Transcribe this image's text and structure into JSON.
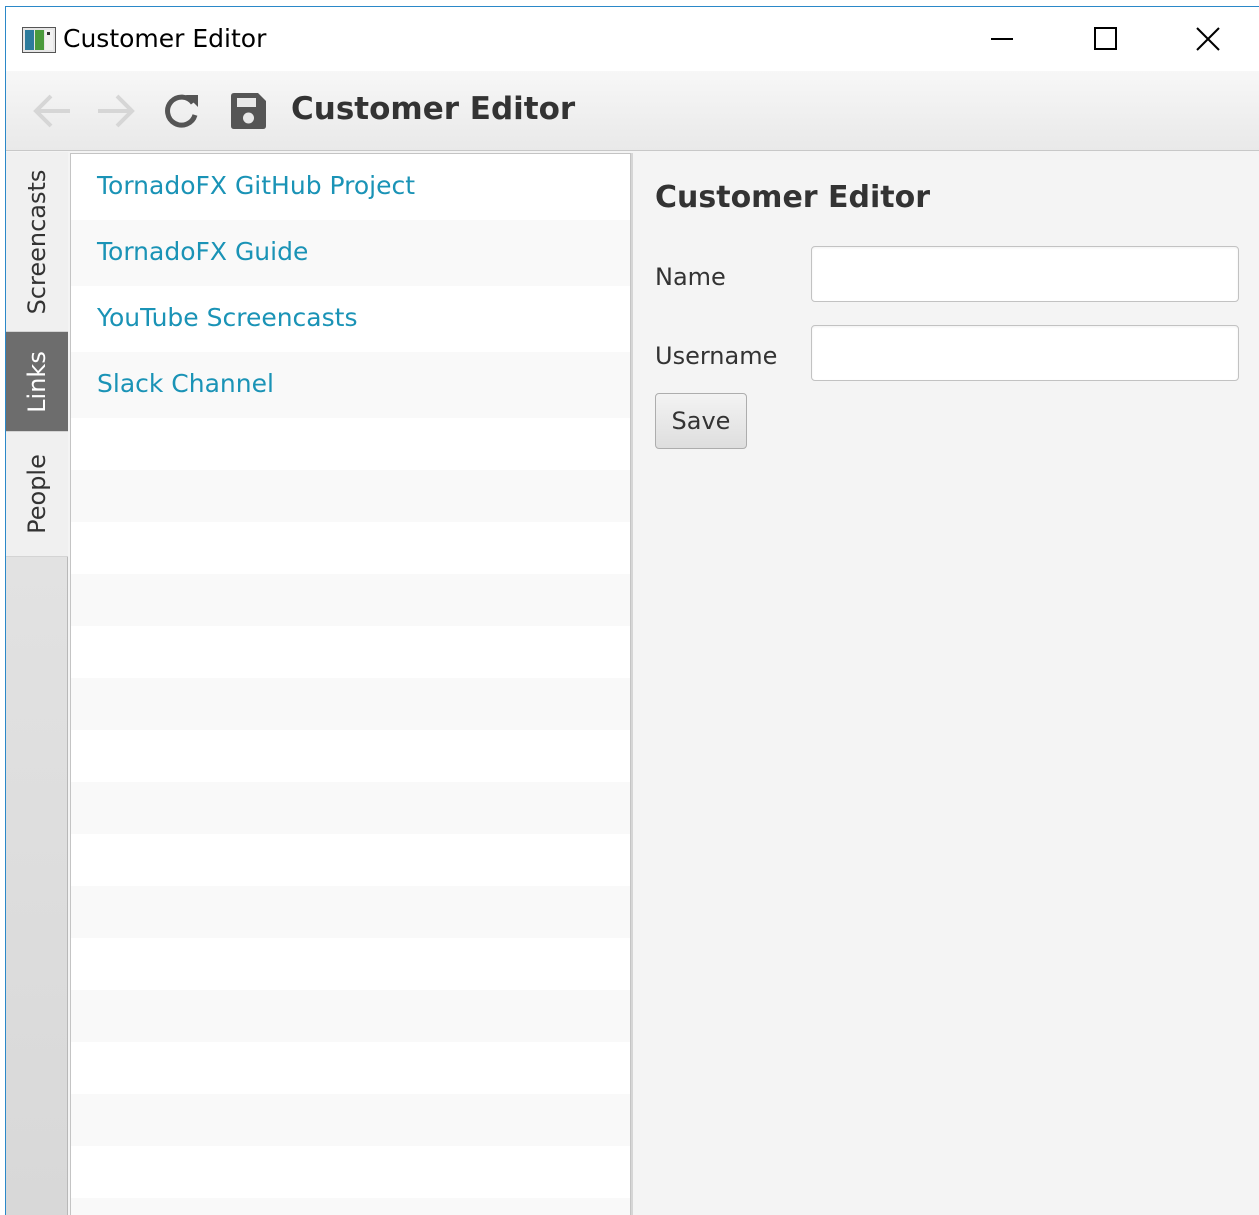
{
  "window": {
    "title": "Customer Editor",
    "controls": {
      "minimize": "minimize-icon",
      "maximize": "maximize-icon",
      "close": "close-icon"
    }
  },
  "toolbar": {
    "title": "Customer Editor",
    "icons": [
      "back-arrow-icon",
      "forward-arrow-icon",
      "refresh-icon",
      "save-disk-icon"
    ]
  },
  "side_tabs": {
    "items": [
      {
        "label": "Screencasts",
        "active": false
      },
      {
        "label": "Links",
        "active": true
      },
      {
        "label": "People",
        "active": false
      }
    ]
  },
  "links": {
    "items": [
      {
        "label": "TornadoFX GitHub Project"
      },
      {
        "label": "TornadoFX Guide"
      },
      {
        "label": "YouTube Screencasts"
      },
      {
        "label": "Slack Channel"
      }
    ]
  },
  "editor": {
    "title": "Customer Editor",
    "name_label": "Name",
    "name_value": "",
    "username_label": "Username",
    "username_value": "",
    "save_label": "Save"
  },
  "colors": {
    "link": "#1a93b6",
    "active_tab": "#6d6d6d",
    "window_border": "#2b88c8"
  }
}
